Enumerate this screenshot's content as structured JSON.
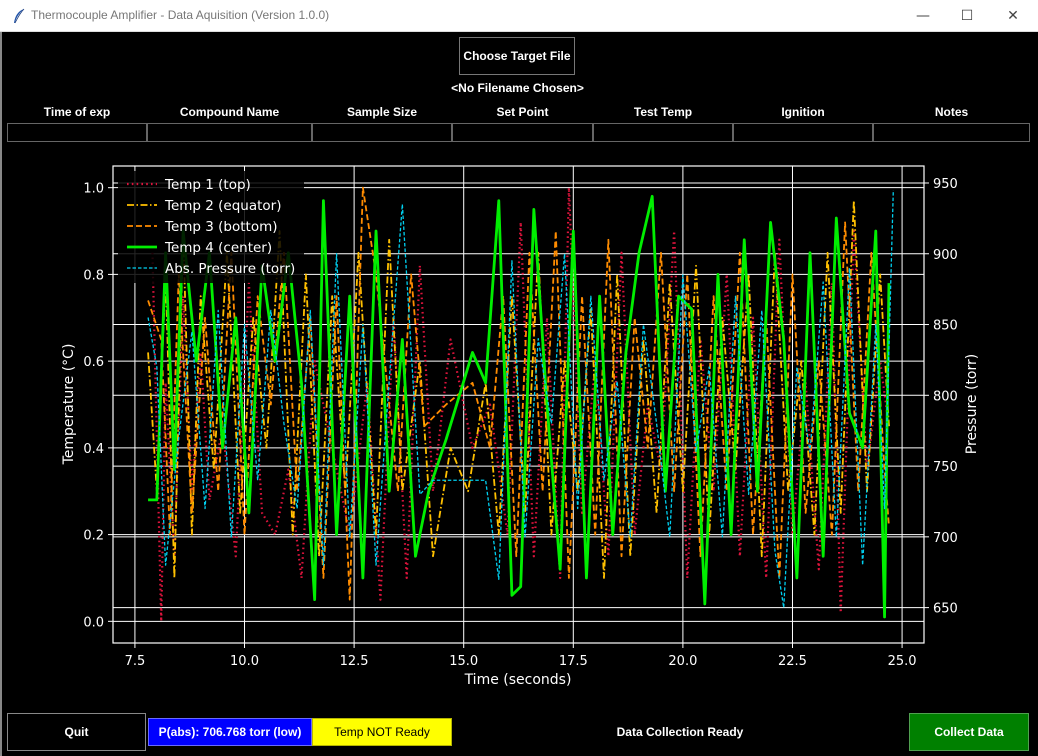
{
  "window": {
    "title": "Thermocouple Amplifier - Data Aquisition (Version 1.0.0)",
    "icon": "feather-icon",
    "controls": {
      "minimize": "—",
      "maximize": "☐",
      "close": "✕"
    }
  },
  "file": {
    "choose_button_label": "Choose Target File",
    "filename_display": "<No Filename Chosen>"
  },
  "fields": [
    {
      "label": "Time of exp",
      "value": ""
    },
    {
      "label": "Compound Name",
      "value": ""
    },
    {
      "label": "Sample Size",
      "value": ""
    },
    {
      "label": "Set Point",
      "value": ""
    },
    {
      "label": "Test Temp",
      "value": ""
    },
    {
      "label": "Ignition",
      "value": ""
    },
    {
      "label": "Notes",
      "value": ""
    }
  ],
  "bottom": {
    "quit_label": "Quit",
    "pressure_status": "P(abs): 706.768 torr (low)",
    "temp_status": "Temp NOT Ready",
    "collection_status": "Data Collection Ready",
    "collect_label": "Collect Data"
  },
  "colors": {
    "pressure_status_bg": "#0000ff",
    "temp_status_bg": "#ffff00",
    "collect_button_bg": "#008000",
    "temp1": "#dc143c",
    "temp2": "#ffc000",
    "temp3": "#ff8c00",
    "temp4": "#00ee00",
    "pressure": "#00d0f0"
  },
  "chart_data": {
    "type": "line",
    "title": "",
    "xlabel": "Time (seconds)",
    "ylabel": "Temperature (°C)",
    "y2label": "Pressure (torr)",
    "xlim": [
      7.0,
      25.5
    ],
    "ylim": [
      -0.05,
      1.05
    ],
    "y2lim": [
      625,
      962
    ],
    "xticks": [
      "7.5",
      "10.0",
      "12.5",
      "15.0",
      "17.5",
      "20.0",
      "22.5",
      "25.0"
    ],
    "yticks": [
      "0.0",
      "0.2",
      "0.4",
      "0.6",
      "0.8",
      "1.0"
    ],
    "y2ticks": [
      "650",
      "700",
      "750",
      "800",
      "850",
      "900",
      "950"
    ],
    "grid": true,
    "legend_position": "top-left",
    "series": [
      {
        "name": "Temp 1 (top)",
        "axis": "left",
        "style": "dotted",
        "x": [
          7.9,
          8.1,
          8.2,
          8.4,
          8.6,
          8.8,
          9.0,
          9.2,
          9.5,
          9.8,
          10.1,
          10.4,
          10.7,
          11.0,
          11.3,
          11.6,
          12.0,
          12.4,
          12.8,
          13.1,
          13.4,
          13.7,
          14.0,
          14.3,
          14.7,
          15.2,
          15.6,
          16.0,
          16.3,
          16.6,
          16.9,
          17.2,
          17.4,
          17.7,
          18.0,
          18.3,
          18.6,
          18.9,
          19.2,
          19.5,
          19.8,
          20.1,
          20.4,
          20.7,
          21.0,
          21.3,
          21.6,
          21.9,
          22.2,
          22.5,
          22.8,
          23.1,
          23.4,
          23.6,
          23.9,
          24.2,
          24.5,
          24.7
        ],
        "y": [
          0.85,
          0.0,
          0.55,
          0.15,
          0.75,
          0.3,
          0.62,
          0.28,
          0.45,
          0.15,
          0.78,
          0.25,
          0.2,
          0.35,
          0.1,
          0.6,
          0.4,
          0.2,
          0.55,
          0.05,
          0.7,
          0.1,
          0.82,
          0.3,
          0.65,
          0.4,
          0.5,
          0.2,
          0.92,
          0.15,
          0.7,
          0.1,
          1.0,
          0.25,
          0.6,
          0.15,
          0.85,
          0.2,
          0.5,
          0.35,
          0.9,
          0.1,
          0.65,
          0.3,
          0.8,
          0.15,
          0.7,
          0.1,
          0.88,
          0.2,
          0.55,
          0.12,
          0.78,
          0.02,
          0.9,
          0.35,
          0.6,
          0.45
        ]
      },
      {
        "name": "Temp 2 (equator)",
        "axis": "left",
        "style": "dashdot",
        "x": [
          7.8,
          8.0,
          8.2,
          8.4,
          8.6,
          8.8,
          9.0,
          9.3,
          9.6,
          9.9,
          10.2,
          10.5,
          10.8,
          11.1,
          11.4,
          11.7,
          12.0,
          12.3,
          12.6,
          13.0,
          13.3,
          13.6,
          14.0,
          14.3,
          14.7,
          15.1,
          15.5,
          15.8,
          16.1,
          16.4,
          16.7,
          17.0,
          17.3,
          17.6,
          17.9,
          18.2,
          18.5,
          18.8,
          19.1,
          19.4,
          19.7,
          20.0,
          20.3,
          20.6,
          20.9,
          21.2,
          21.5,
          21.8,
          22.1,
          22.4,
          22.7,
          23.0,
          23.3,
          23.6,
          23.9,
          24.2,
          24.5,
          24.7
        ],
        "y": [
          0.62,
          0.3,
          0.8,
          0.1,
          0.9,
          0.2,
          0.75,
          0.35,
          0.85,
          0.25,
          0.7,
          0.4,
          0.9,
          0.2,
          0.8,
          0.15,
          0.75,
          0.3,
          0.85,
          0.2,
          0.88,
          0.3,
          0.6,
          0.15,
          0.4,
          0.3,
          0.55,
          0.2,
          0.75,
          0.25,
          0.85,
          0.2,
          0.6,
          0.3,
          0.72,
          0.1,
          0.8,
          0.15,
          0.65,
          0.25,
          0.78,
          0.3,
          0.82,
          0.2,
          0.7,
          0.35,
          0.8,
          0.15,
          0.85,
          0.3,
          0.6,
          0.2,
          0.85,
          0.25,
          0.97,
          0.3,
          0.8,
          0.45
        ]
      },
      {
        "name": "Temp 3 (bottom)",
        "axis": "left",
        "style": "dashed",
        "x": [
          7.8,
          8.1,
          8.3,
          8.5,
          8.8,
          9.1,
          9.4,
          9.7,
          10.0,
          10.3,
          10.6,
          10.9,
          11.2,
          11.5,
          11.8,
          12.1,
          12.4,
          12.7,
          13.0,
          13.2,
          13.5,
          13.8,
          14.1,
          14.6,
          15.2,
          15.6,
          15.9,
          16.2,
          16.5,
          16.8,
          17.1,
          17.4,
          17.7,
          18.0,
          18.3,
          18.6,
          18.9,
          19.2,
          19.5,
          19.8,
          20.1,
          20.4,
          20.7,
          21.0,
          21.3,
          21.6,
          21.9,
          22.2,
          22.5,
          22.8,
          23.1,
          23.4,
          23.7,
          24.0,
          24.3,
          24.6,
          24.7
        ],
        "y": [
          0.74,
          0.65,
          0.2,
          0.8,
          0.25,
          0.7,
          0.3,
          0.85,
          0.2,
          0.75,
          0.5,
          0.85,
          0.3,
          0.7,
          0.1,
          0.75,
          0.05,
          1.0,
          0.8,
          0.6,
          0.3,
          0.8,
          0.45,
          0.5,
          0.55,
          0.4,
          0.75,
          0.15,
          0.85,
          0.3,
          0.9,
          0.1,
          0.75,
          0.2,
          0.88,
          0.15,
          0.7,
          0.4,
          0.85,
          0.3,
          0.8,
          0.15,
          0.75,
          0.3,
          0.85,
          0.2,
          0.7,
          0.1,
          0.8,
          0.25,
          0.6,
          0.2,
          0.92,
          0.3,
          0.85,
          0.35,
          0.22
        ]
      },
      {
        "name": "Temp 4 (center)",
        "axis": "left",
        "style": "solid",
        "x": [
          7.8,
          8.0,
          8.2,
          8.4,
          8.6,
          8.9,
          9.2,
          9.5,
          9.8,
          10.1,
          10.4,
          10.7,
          11.0,
          11.3,
          11.6,
          11.8,
          12.1,
          12.4,
          12.7,
          13.0,
          13.3,
          13.6,
          13.9,
          14.2,
          14.6,
          15.2,
          15.5,
          15.8,
          16.1,
          16.3,
          16.6,
          16.9,
          17.2,
          17.5,
          17.8,
          18.1,
          18.4,
          18.7,
          19.0,
          19.3,
          19.6,
          19.9,
          20.2,
          20.5,
          20.8,
          21.1,
          21.4,
          21.7,
          22.0,
          22.3,
          22.6,
          22.9,
          23.2,
          23.5,
          23.8,
          24.1,
          24.4,
          24.6,
          24.7
        ],
        "y": [
          0.28,
          0.28,
          0.85,
          0.35,
          0.9,
          0.6,
          0.85,
          0.4,
          0.7,
          0.25,
          0.82,
          0.6,
          0.85,
          0.55,
          0.05,
          0.97,
          0.2,
          0.75,
          0.1,
          0.9,
          0.3,
          0.65,
          0.15,
          0.3,
          0.42,
          0.62,
          0.55,
          0.97,
          0.06,
          0.08,
          0.95,
          0.5,
          0.12,
          0.9,
          0.1,
          0.75,
          0.2,
          0.62,
          0.85,
          0.98,
          0.3,
          0.75,
          0.72,
          0.04,
          0.8,
          0.2,
          0.88,
          0.3,
          0.92,
          0.65,
          0.1,
          0.85,
          0.15,
          0.93,
          0.48,
          0.4,
          0.9,
          0.01,
          0.78
        ]
      },
      {
        "name": "Abs. Pressure (torr)",
        "axis": "right",
        "style": "dashed-fine",
        "x": [
          7.8,
          8.0,
          8.2,
          8.5,
          8.8,
          9.1,
          9.4,
          9.7,
          10.0,
          10.3,
          10.6,
          10.9,
          11.2,
          11.5,
          11.8,
          12.1,
          12.4,
          12.7,
          13.0,
          13.3,
          13.6,
          14.0,
          14.3,
          15.5,
          15.8,
          16.1,
          16.4,
          16.7,
          17.0,
          17.3,
          17.6,
          17.9,
          18.2,
          18.5,
          18.8,
          19.1,
          19.4,
          19.7,
          20.0,
          20.3,
          20.6,
          20.9,
          21.2,
          21.5,
          21.8,
          22.1,
          22.3,
          22.6,
          22.9,
          23.2,
          23.5,
          23.8,
          24.1,
          24.4,
          24.6,
          24.8
        ],
        "y": [
          855,
          820,
          680,
          770,
          845,
          720,
          860,
          700,
          850,
          740,
          860,
          780,
          720,
          860,
          680,
          900,
          700,
          850,
          680,
          810,
          935,
          730,
          740,
          740,
          670,
          895,
          700,
          840,
          780,
          900,
          720,
          870,
          740,
          810,
          700,
          850,
          780,
          700,
          885,
          760,
          820,
          700,
          870,
          730,
          860,
          690,
          650,
          820,
          760,
          880,
          700,
          890,
          680,
          850,
          720,
          945
        ]
      }
    ]
  }
}
